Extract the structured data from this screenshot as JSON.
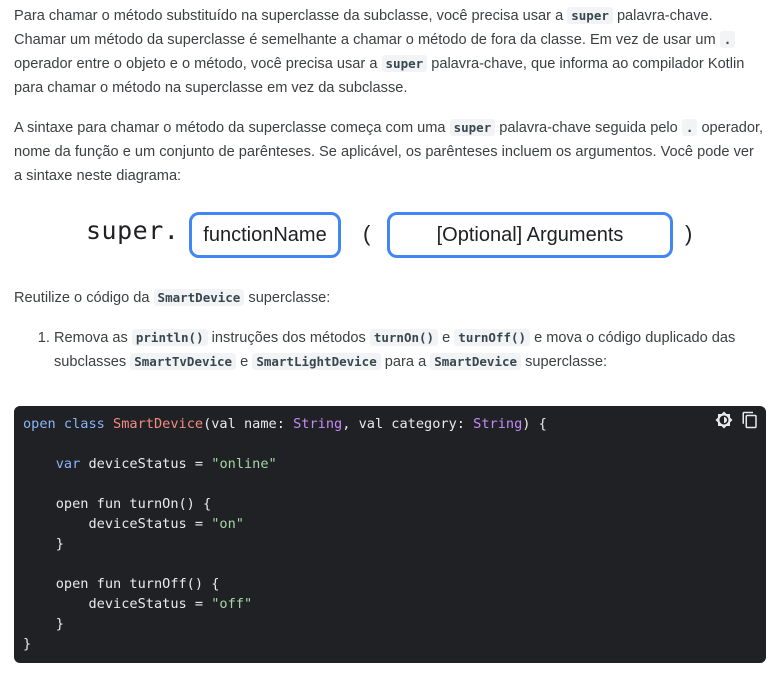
{
  "paragraphs": {
    "p1": {
      "t1": "Para chamar o método substituído na superclasse da subclasse, você precisa usar a ",
      "c1": "super",
      "t2": " palavra-chave. Chamar um método da superclasse é semelhante a chamar o método de fora da classe. Em vez de usar um ",
      "c2": ".",
      "t3": " operador entre o objeto e o método, você precisa usar a ",
      "c3": "super",
      "t4": " palavra-chave, que informa ao compilador Kotlin para chamar o método na superclasse em vez da subclasse."
    },
    "p2": {
      "t1": "A sintaxe para chamar o método da superclasse começa com uma ",
      "c1": "super",
      "t2": " palavra-chave seguida pelo ",
      "c2": ".",
      "t3": " operador, nome da função e um conjunto de parênteses. Se aplicável, os parênteses incluem os argumentos. Você pode ver a sintaxe neste diagrama:"
    },
    "p3": {
      "t1": "Reutilize o código da ",
      "c1": "SmartDevice",
      "t2": " superclasse:"
    }
  },
  "diagram": {
    "keyword": "super.",
    "function_name": "functionName",
    "open_paren": "(",
    "arguments": "[Optional] Arguments",
    "close_paren": ")",
    "box_color": "#4285f4"
  },
  "steps": [
    {
      "t1": "Remova as ",
      "c1": "println()",
      "t2": " instruções dos métodos ",
      "c2": "turnOn()",
      "t3": " e ",
      "c3": "turnOff()",
      "t4": " e mova o código duplicado das subclasses ",
      "c4": "SmartTvDevice",
      "t5": " e ",
      "c5": "SmartLightDevice",
      "t6": " para a ",
      "c6": "SmartDevice",
      "t7": " superclasse:"
    }
  ],
  "code": {
    "l1": {
      "a": "open ",
      "b": "class ",
      "c": "SmartDevice",
      "d": "(val name: ",
      "e": "String",
      "f": ", val category: ",
      "g": "String",
      "h": ") {"
    },
    "l3": {
      "a": "    ",
      "b": "var ",
      "c": "deviceStatus = ",
      "d": "\"online\""
    },
    "l5": "    open fun turnOn() {",
    "l6": {
      "a": "        deviceStatus = ",
      "b": "\"on\""
    },
    "l7": "    }",
    "l9": "    open fun turnOff() {",
    "l10": {
      "a": "        deviceStatus = ",
      "b": "\"off\""
    },
    "l11": "    }",
    "l12": "}",
    "background": "#202124",
    "tools": {
      "theme_icon": "brightness-icon",
      "copy_icon": "copy-icon"
    }
  }
}
